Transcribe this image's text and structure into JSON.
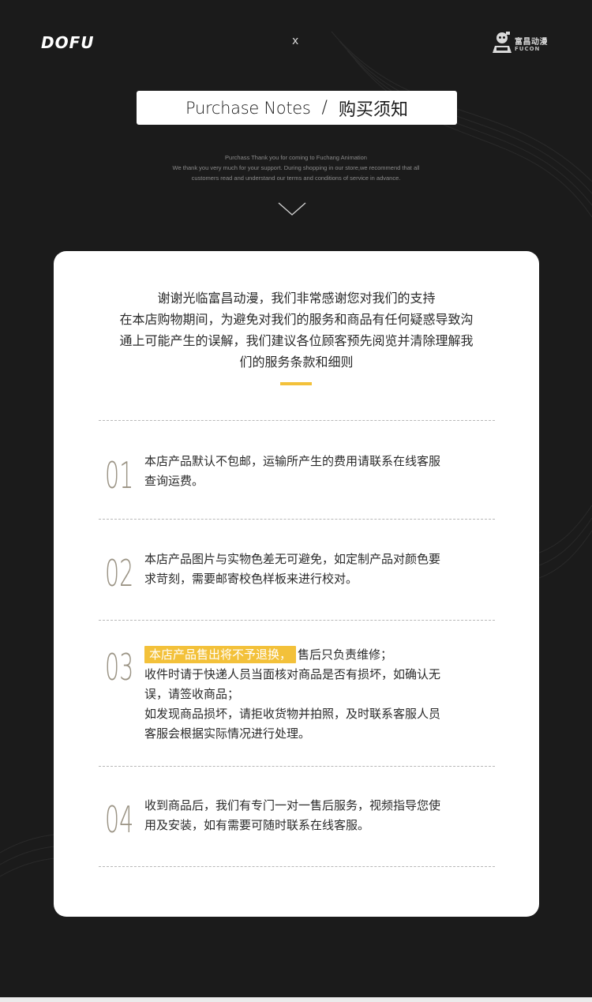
{
  "header": {
    "left_brand": "DOFU",
    "separator": "x",
    "right_brand_cn": "富昌动漫",
    "right_brand_en": "FUCON"
  },
  "title": {
    "english": "Purchase Notes",
    "slash": "/",
    "chinese": "购买须知"
  },
  "subtext": {
    "line1": "Purchass Thank you for coming to Fuchang Animation",
    "line2": "We thank you very much for your support. During shopping in our store,we recommend that all",
    "line3": "customers read and understand our terms and conditions of service in advance."
  },
  "intro": {
    "line1": "谢谢光临富昌动漫，我们非常感谢您对我们的支持",
    "line2": "在本店购物期间，为避免对我们的服务和商品有任何疑惑导致沟",
    "line3": "通上可能产生的误解，我们建议各位顾客预先阅览并清除理解我",
    "line4": "们的服务条款和细则"
  },
  "items": [
    {
      "number": "01",
      "lines": [
        "本店产品默认不包邮，运输所产生的费用请联系在线客服",
        "查询运费。"
      ]
    },
    {
      "number": "02",
      "lines": [
        "本店产品图片与实物色差无可避免，如定制产品对颜色要",
        "求苛刻，需要邮寄校色样板来进行校对。"
      ]
    },
    {
      "number": "03",
      "highlight": "本店产品售出将不予退换，",
      "first_rest": "售后只负责维修；",
      "lines": [
        "收件时请于快递人员当面核对商品是否有损坏，如确认无",
        "误，请签收商品；",
        "如发现商品损坏，请拒收货物并拍照，及时联系客服人员",
        "客服会根据实际情况进行处理。"
      ]
    },
    {
      "number": "04",
      "lines": [
        "收到商品后，我们有专门一对一售后服务，视频指导您使",
        "用及安装，如有需要可随时联系在线客服。"
      ]
    }
  ],
  "colors": {
    "background": "#1b1b1b",
    "card": "#ffffff",
    "accent": "#f3c13a",
    "number": "#9a9384"
  }
}
